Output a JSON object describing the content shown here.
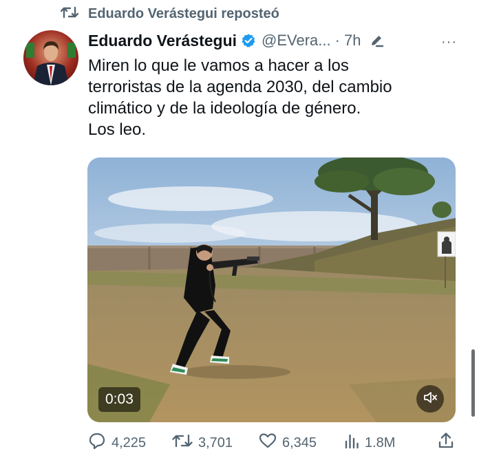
{
  "repost": {
    "label": "Eduardo Verástegui reposteó",
    "icon": "repost-icon"
  },
  "tweet": {
    "author_name": "Eduardo Verástegui",
    "handle": "@EVera...",
    "separator": "·",
    "time": "7h",
    "more": "···",
    "lines": [
      "Miren lo que le vamos a hacer a los",
      "terroristas de la  agenda 2030, del cambio",
      "climático y de la ideología de género.",
      "Los leo."
    ]
  },
  "media": {
    "timestamp": "0:03",
    "icons": [
      "mute-icon",
      "gif-icon"
    ]
  },
  "actions": {
    "replies": "4,225",
    "reposts": "3,701",
    "likes": "6,345",
    "views": "1.8M"
  },
  "colors": {
    "verified": "#1d9bf0",
    "muted_text": "#536471",
    "text": "#0f1419"
  }
}
